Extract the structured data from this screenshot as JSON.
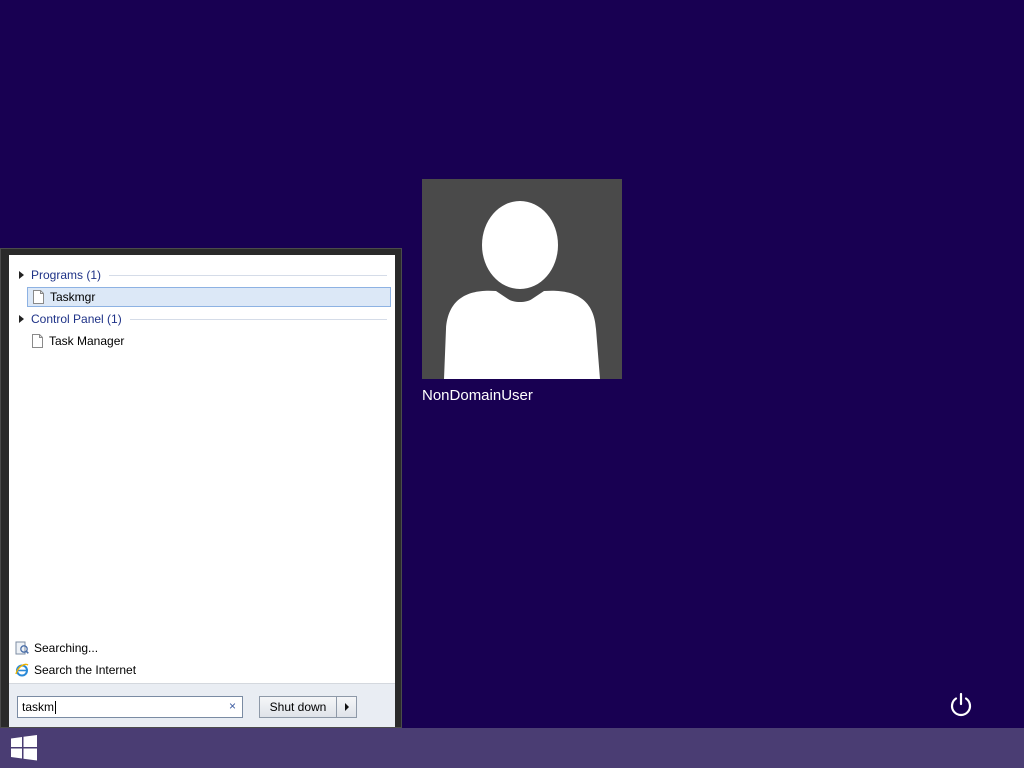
{
  "user": {
    "name": "NonDomainUser"
  },
  "start_menu": {
    "groups": [
      {
        "header": "Programs (1)",
        "items": [
          "Taskmgr"
        ]
      },
      {
        "header": "Control Panel (1)",
        "items": [
          "Task Manager"
        ]
      }
    ],
    "searching_label": "Searching...",
    "search_internet_label": "Search the Internet",
    "search": {
      "value": "taskm",
      "clear_glyph": "×"
    },
    "shutdown_label": "Shut down"
  },
  "colors": {
    "background": "#180052",
    "taskbar": "#4a3d73",
    "selection": "#dce8f7",
    "group_header": "#1e3287"
  },
  "icons": [
    "document-icon",
    "searching-icon",
    "internet-explorer-icon",
    "windows-logo-icon",
    "power-icon",
    "user-avatar-icon"
  ]
}
